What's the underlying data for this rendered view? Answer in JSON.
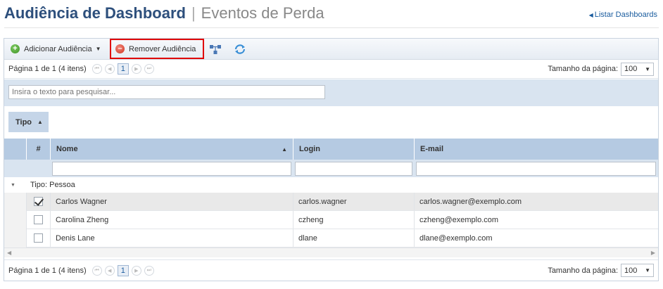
{
  "header": {
    "title": "Audiência de Dashboard",
    "separator": "|",
    "subtitle": "Eventos de Perda",
    "list_link": "Listar Dashboards"
  },
  "toolbar": {
    "add_label": "Adicionar Audiência",
    "remove_label": "Remover Audiência"
  },
  "pager": {
    "text": "Página 1 de 1 (4 itens)",
    "current_page": "1",
    "page_size_label": "Tamanho da página:",
    "page_size": "100"
  },
  "search": {
    "placeholder": "Insira o texto para pesquisar..."
  },
  "grouping": {
    "chip_label": "Tipo"
  },
  "columns": {
    "index": "#",
    "name": "Nome",
    "login": "Login",
    "email": "E-mail"
  },
  "group": {
    "label": "Tipo: Pessoa"
  },
  "rows": [
    {
      "name": "Carlos Wagner",
      "login": "carlos.wagner",
      "email": "carlos.wagner@exemplo.com",
      "checked": true
    },
    {
      "name": "Carolina Zheng",
      "login": "czheng",
      "email": "czheng@exemplo.com",
      "checked": false
    },
    {
      "name": "Denis Lane",
      "login": "dlane",
      "email": "dlane@exemplo.com",
      "checked": false
    }
  ],
  "colors": {
    "title": "#2d4f7c",
    "link": "#1a5c9e",
    "highlight_border": "#e00000",
    "header_bg": "#b5cae2"
  }
}
